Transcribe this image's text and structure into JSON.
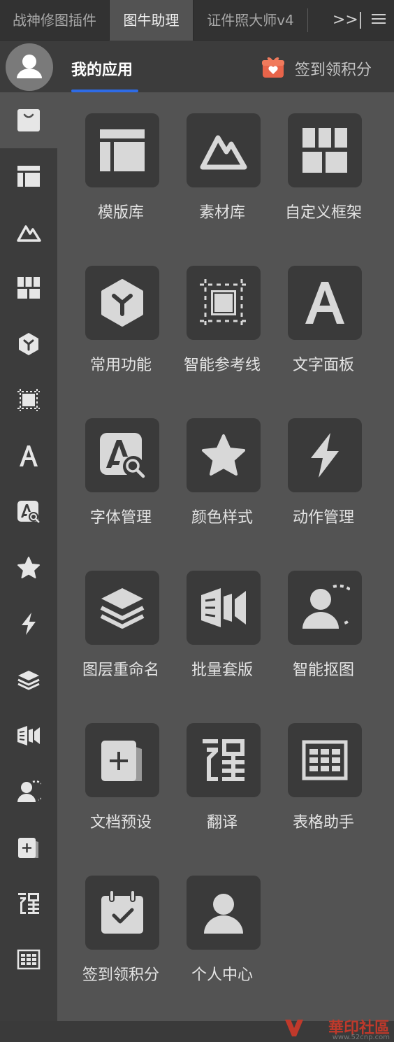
{
  "tabs": [
    {
      "label": "战神修图插件"
    },
    {
      "label": "图牛助理"
    },
    {
      "label": "证件照大师v4"
    }
  ],
  "tabbar": {
    "more_label": ">>"
  },
  "header": {
    "nav_title": "我的应用",
    "checkin_label": "签到领积分"
  },
  "apps": [
    {
      "label": "模版库",
      "icon": "template-icon"
    },
    {
      "label": "素材库",
      "icon": "mountain-icon"
    },
    {
      "label": "自定义框架",
      "icon": "grid-blocks-icon"
    },
    {
      "label": "常用功能",
      "icon": "hexagon-y-icon"
    },
    {
      "label": "智能参考线",
      "icon": "guides-icon"
    },
    {
      "label": "文字面板",
      "icon": "letter-a-icon"
    },
    {
      "label": "字体管理",
      "icon": "font-search-icon"
    },
    {
      "label": "颜色样式",
      "icon": "star-icon"
    },
    {
      "label": "动作管理",
      "icon": "lightning-icon"
    },
    {
      "label": "图层重命名",
      "icon": "layers-icon"
    },
    {
      "label": "批量套版",
      "icon": "batch-icon"
    },
    {
      "label": "智能抠图",
      "icon": "person-cutout-icon"
    },
    {
      "label": "文档预设",
      "icon": "document-add-icon"
    },
    {
      "label": "翻译",
      "icon": "translate-icon"
    },
    {
      "label": "表格助手",
      "icon": "table-icon"
    },
    {
      "label": "签到领积分",
      "icon": "calendar-check-icon"
    },
    {
      "label": "个人中心",
      "icon": "user-icon"
    }
  ],
  "watermark": {
    "text": "華印社區",
    "url": "www.52cnp.com"
  },
  "colors": {
    "accent": "#2e6be6",
    "gift": "#e8644a"
  }
}
